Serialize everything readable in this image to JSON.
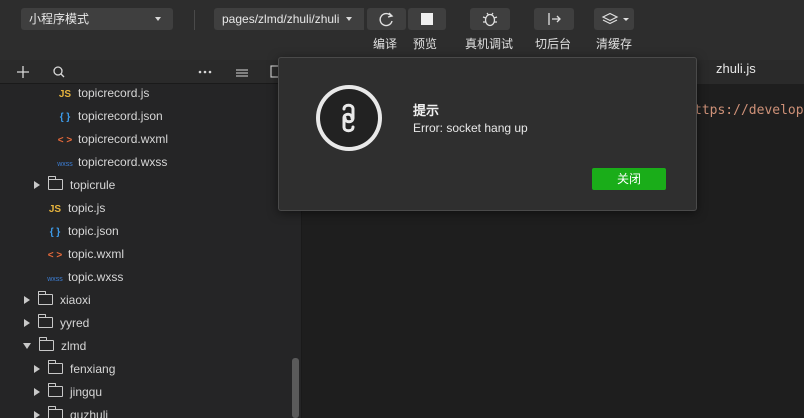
{
  "toolbar": {
    "mode": "小程序模式",
    "page_path": "pages/zlmd/zhuli/zhuli",
    "buttons": [
      {
        "label": "编译",
        "icon": "refresh-icon"
      },
      {
        "label": "预览",
        "icon": "preview-icon"
      },
      {
        "label": "真机调试",
        "icon": "bug-icon"
      },
      {
        "label": "切后台",
        "icon": "switch-background-icon"
      },
      {
        "label": "清缓存",
        "icon": "layers-icon"
      }
    ]
  },
  "editor": {
    "active_tab": "zhuli.js",
    "code_fragment": "ttps://develope"
  },
  "tree": {
    "items": [
      {
        "label": "topicrecord.js",
        "kind": "js",
        "badge": "JS"
      },
      {
        "label": "topicrecord.json",
        "kind": "json",
        "badge": "{ }"
      },
      {
        "label": "topicrecord.wxml",
        "kind": "wxml",
        "badge": "< >"
      },
      {
        "label": "topicrecord.wxss",
        "kind": "wxss",
        "badge": "wxss"
      },
      {
        "label": "topicrule",
        "kind": "folder"
      },
      {
        "label": "topic.js",
        "kind": "js",
        "badge": "JS"
      },
      {
        "label": "topic.json",
        "kind": "json",
        "badge": "{ }"
      },
      {
        "label": "topic.wxml",
        "kind": "wxml",
        "badge": "< >"
      },
      {
        "label": "topic.wxss",
        "kind": "wxss",
        "badge": "wxss"
      },
      {
        "label": "xiaoxi",
        "kind": "folder"
      },
      {
        "label": "yyred",
        "kind": "folder"
      },
      {
        "label": "zlmd",
        "kind": "folder-open"
      },
      {
        "label": "fenxiang",
        "kind": "folder"
      },
      {
        "label": "jingqu",
        "kind": "folder"
      },
      {
        "label": "quzhuli",
        "kind": "folder"
      }
    ]
  },
  "modal": {
    "title": "提示",
    "message": "Error: socket hang up",
    "close_label": "关闭"
  },
  "colors": {
    "accent_green": "#1aad19",
    "background": "#1e1e1e",
    "toolbar": "#2d2d2d"
  }
}
